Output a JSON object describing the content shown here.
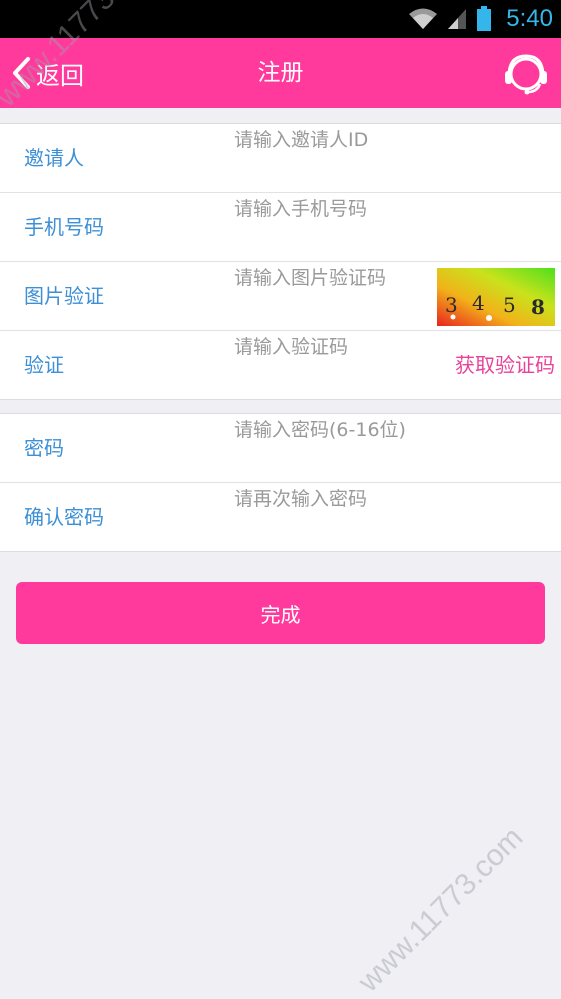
{
  "status_bar": {
    "time": "5:40",
    "icons": [
      "wifi-icon",
      "signal-icon",
      "battery-icon"
    ]
  },
  "header": {
    "back_label": "返回",
    "title": "注册",
    "service_icon": "customer-service-icon"
  },
  "form": {
    "group1": [
      {
        "label": "邀请人",
        "placeholder": "请输入邀请人ID"
      },
      {
        "label": "手机号码",
        "placeholder": "请输入手机号码"
      },
      {
        "label": "图片验证",
        "placeholder": "请输入图片验证码"
      },
      {
        "label": "验证",
        "placeholder": "请输入验证码"
      }
    ],
    "group2": [
      {
        "label": "密码",
        "placeholder": "请输入密码(6-16位)"
      },
      {
        "label": "确认密码",
        "placeholder": "请再次输入密码"
      }
    ],
    "captcha_text": [
      "3",
      "4",
      "5",
      "8"
    ],
    "get_code_label": "获取验证码"
  },
  "submit_label": "完成",
  "watermark": "www.11773.com",
  "colors": {
    "brand_pink": "#ff3a9c",
    "label_blue": "#3d8fd6",
    "link_pink": "#e8439a",
    "background": "#efeff4",
    "status_time": "#35b6ea"
  }
}
